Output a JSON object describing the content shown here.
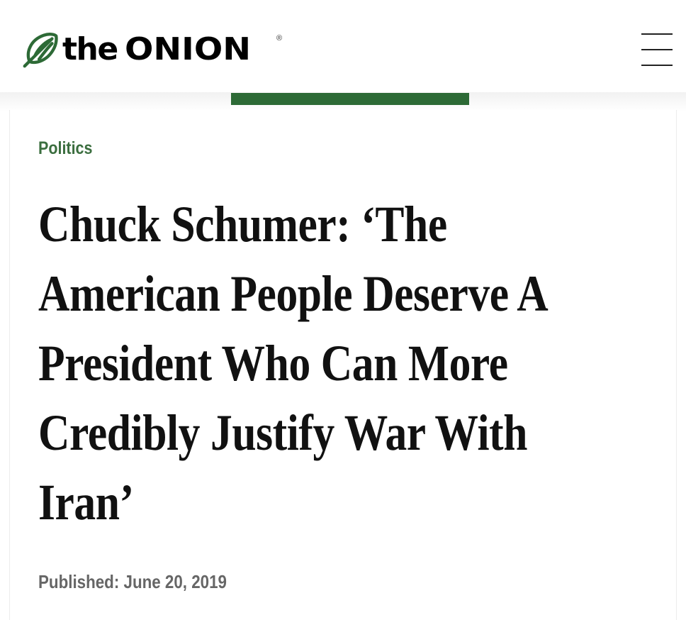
{
  "header": {
    "logo": {
      "the": "the",
      "onion": "ONION",
      "registered_mark": "®",
      "icon": "onion-leaf-icon"
    },
    "menu_icon": "hamburger-menu-icon"
  },
  "progress": {
    "value": 0.35,
    "color": "#2d6a36"
  },
  "article": {
    "category": "Politics",
    "category_color": "#3b6e3f",
    "headline_lines": [
      "Chuck Schumer: ‘The",
      "American People Deserve A",
      "President Who Can More",
      "Credibly Justify War With",
      "Iran’"
    ],
    "published_label": "Published:",
    "published_date": "June 20, 2019"
  }
}
